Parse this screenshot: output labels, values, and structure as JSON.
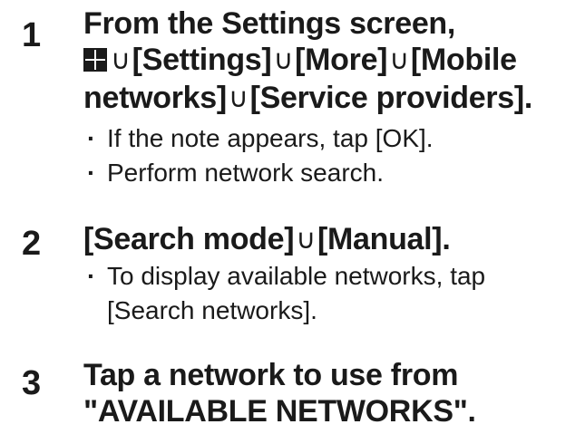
{
  "steps": [
    {
      "number": "1",
      "heading": {
        "line1": "From the Settings screen,",
        "icon": "apps-grid-icon",
        "separator": "∪",
        "items": [
          "[Settings]",
          "[More]",
          "[Mobile",
          "networks]",
          "[Service providers]."
        ]
      },
      "bullets": [
        "If the note appears, tap [OK].",
        "Perform network search."
      ]
    },
    {
      "number": "2",
      "heading": {
        "separator": "∪",
        "items": [
          "[Search mode]",
          "[Manual]."
        ]
      },
      "bullets": [
        "To display available networks, tap",
        "[Search networks]."
      ]
    },
    {
      "number": "3",
      "heading": {
        "line1": "Tap a network to use from",
        "line2": "\"AVAILABLE NETWORKS\"."
      }
    }
  ]
}
